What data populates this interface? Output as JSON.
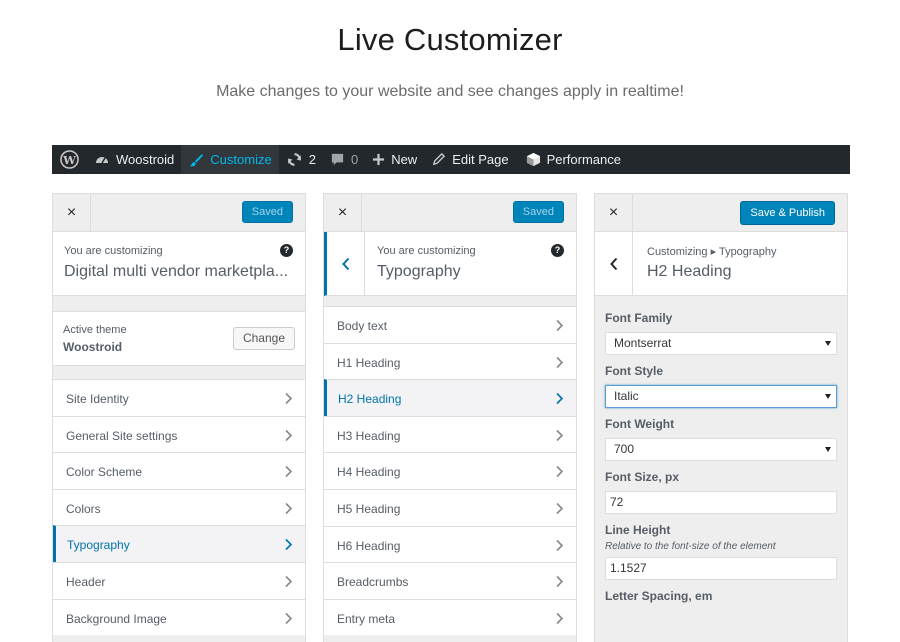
{
  "hero": {
    "title": "Live Customizer",
    "subtitle": "Make changes to your website and see changes apply in realtime!"
  },
  "admin_bar": {
    "site_name": "Woostroid",
    "customize": "Customize",
    "updates_count": "2",
    "comments_count": "0",
    "new": "New",
    "edit_page": "Edit Page",
    "performance": "Performance"
  },
  "colors": {
    "accent": "#0073aa",
    "button": "#0085ba",
    "admin_bar_bg": "#23282d",
    "customize_active": "#00b9eb"
  },
  "panel1": {
    "close": "×",
    "saved_label": "Saved",
    "customizing_label": "You are customizing",
    "site_title": "Digital multi vendor marketpla...",
    "active_theme_label": "Active theme",
    "theme_name": "Woostroid",
    "change_label": "Change",
    "sections": [
      "Site Identity",
      "General Site settings",
      "Color Scheme",
      "Colors",
      "Typography",
      "Header",
      "Background Image"
    ],
    "active_section": "Typography"
  },
  "panel2": {
    "close": "×",
    "saved_label": "Saved",
    "customizing_label": "You are customizing",
    "title": "Typography",
    "sections": [
      "Body text",
      "H1 Heading",
      "H2 Heading",
      "H3 Heading",
      "H4 Heading",
      "H5 Heading",
      "H6 Heading",
      "Breadcrumbs",
      "Entry meta"
    ],
    "active_section": "H2 Heading"
  },
  "panel3": {
    "close": "×",
    "publish_label": "Save & Publish",
    "breadcrumb": "Customizing ▸ Typography",
    "title": "H2 Heading",
    "font_family_label": "Font Family",
    "font_family_value": "Montserrat",
    "font_style_label": "Font Style",
    "font_style_value": "Italic",
    "font_weight_label": "Font Weight",
    "font_weight_value": "700",
    "font_size_label": "Font Size, px",
    "font_size_value": "72",
    "line_height_label": "Line Height",
    "line_height_desc": "Relative to the font-size of the element",
    "line_height_value": "1.1527",
    "letter_spacing_label": "Letter Spacing, em"
  }
}
